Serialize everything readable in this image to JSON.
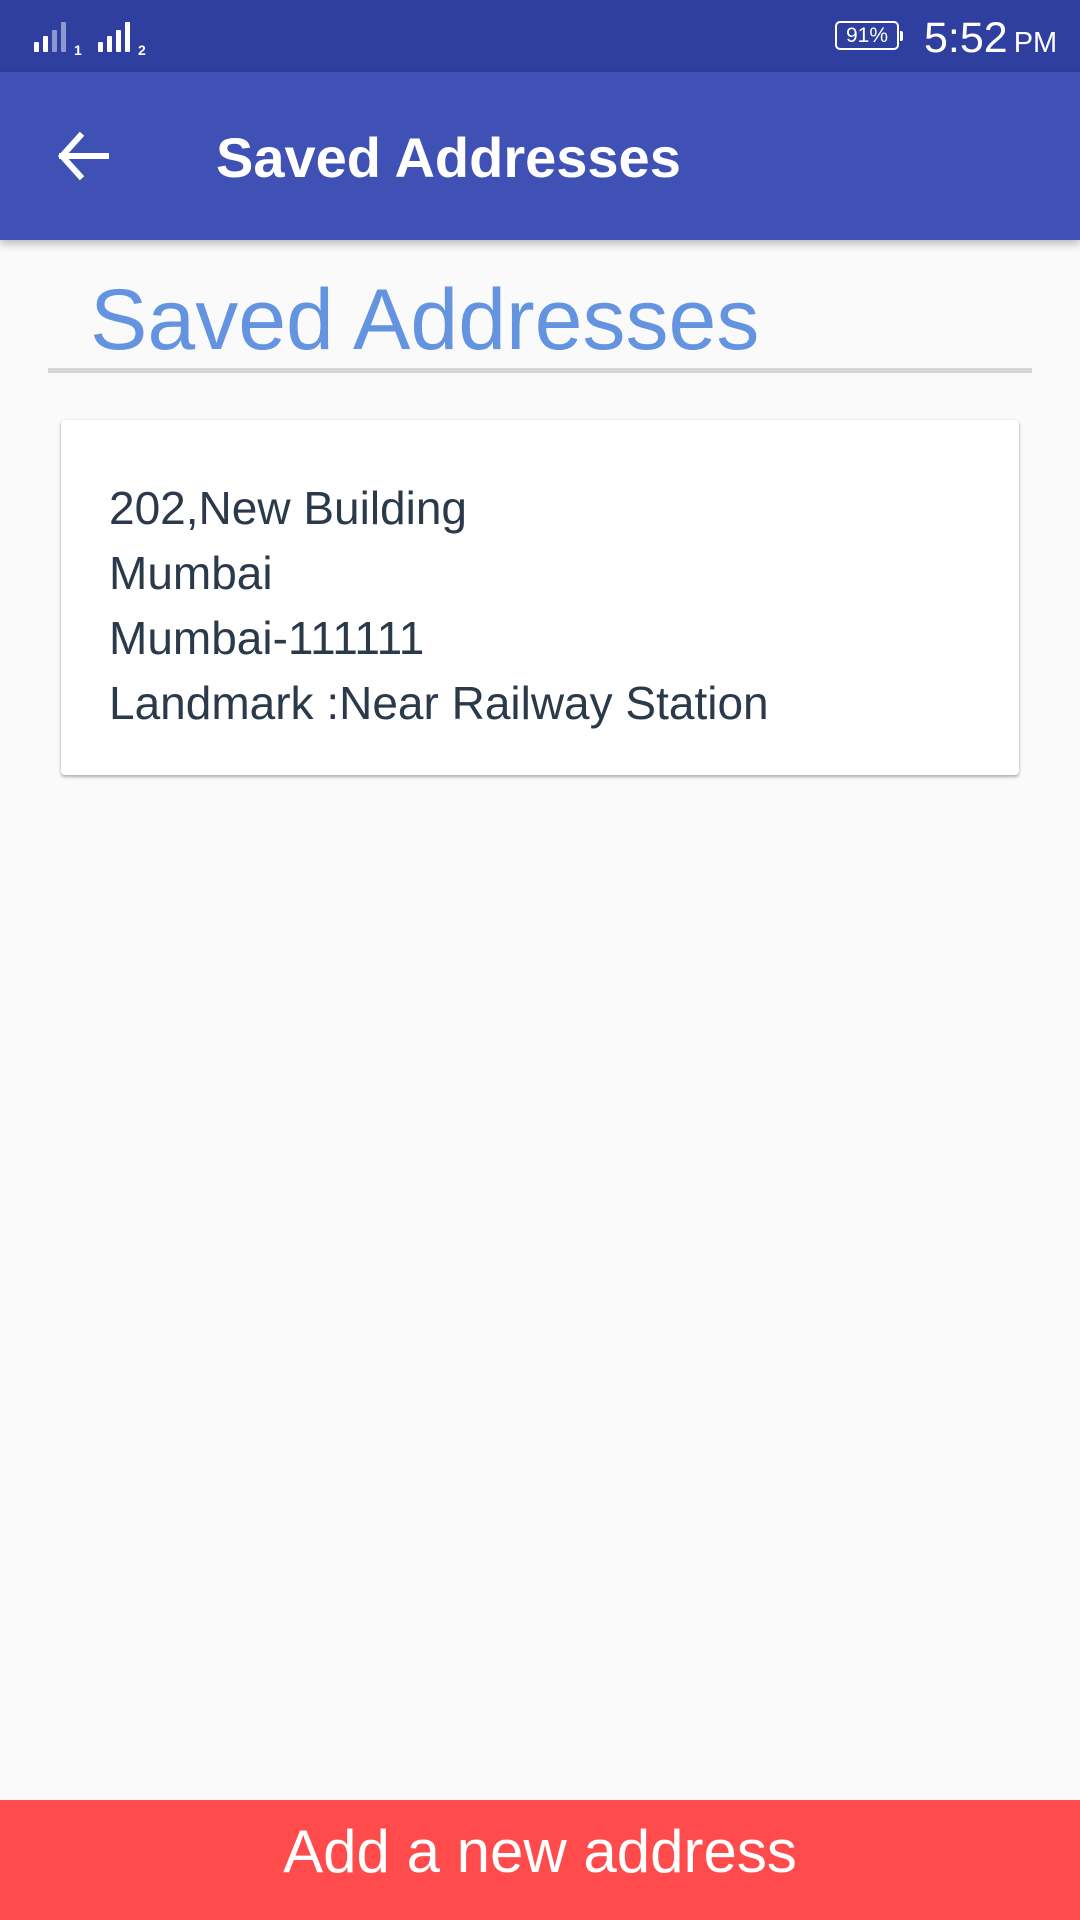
{
  "status_bar": {
    "sim1_label": "1",
    "sim2_label": "2",
    "battery": "91%",
    "time": "5:52",
    "ampm": "PM"
  },
  "toolbar": {
    "back_icon": "arrow-left-icon",
    "title": "Saved Addresses"
  },
  "content": {
    "heading": "Saved Addresses",
    "addresses": [
      {
        "line1": "202,New Building",
        "line2": "Mumbai",
        "line3": "Mumbai-111111",
        "line4": "Landmark :Near Railway Station"
      }
    ]
  },
  "footer": {
    "add_button_label": "Add a new address"
  },
  "colors": {
    "status_bar": "#2f3f9f",
    "toolbar": "#3f51b5",
    "heading": "#6493e0",
    "add_button": "#ff4b4b"
  }
}
